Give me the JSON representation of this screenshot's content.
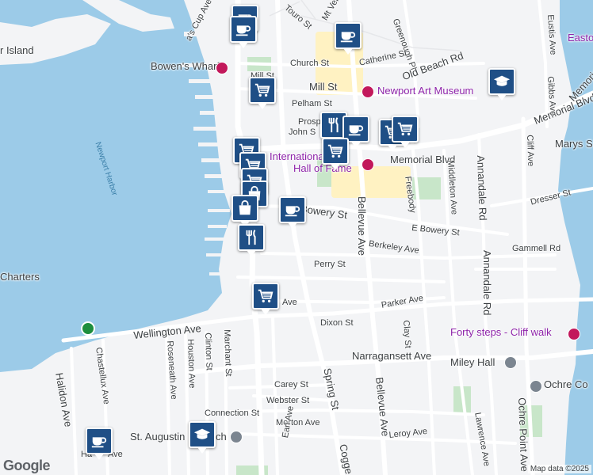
{
  "map": {
    "attribution": "Map data ©2025",
    "logo": "Google",
    "labels": {
      "island": "r Island",
      "newport_harbor": "Newport Harbor",
      "charters": "Charters",
      "americas_cup_ave": "a's Cup Ave",
      "bowens_wharf": "Bowen's Wharf",
      "touro_st": "Touro St",
      "mt_vernon": "Mt Vern",
      "greenough_pl": "Greenough Pl",
      "catherine_st": "Catherine St",
      "old_beach_rd": "Old Beach Rd",
      "church_st": "Church St",
      "mill_st_w": "Mill St",
      "mill_st_e": "Mill St",
      "pelham_st": "Pelham St",
      "newport_art_museum": "Newport Art Museum",
      "prospect": "Prosp",
      "john_s": "John S",
      "intl_tennis": "International",
      "hall_of_fame": "Hall of Fame",
      "memorial_blvd": "Memorial Blvd",
      "memorial_blvd_e": "Memorial Blvd",
      "bowery_st": "Bowery St",
      "e_bowery_st": "E Bowery St",
      "bellevue_ave": "Bellevue Ave",
      "freebody": "Freebody",
      "middleton_ave": "Middleton Ave",
      "annandale_rd": "Annandale Rd",
      "annandale_rd2": "Annandale Rd",
      "dresser_st": "Dresser St",
      "gammell_rd": "Gammell Rd",
      "berkeley_ave": "Berkeley Ave",
      "perry_st": "Perry St",
      "parker_ave": "Parker Ave",
      "ave_small": "Ave",
      "dixon_st": "Dixon St",
      "wellington_ave": "Wellington Ave",
      "forty_steps": "Forty steps - Cliff walk",
      "narragansett_ave": "Narragansett Ave",
      "miley_hall": "Miley Hall",
      "ochre_court": "Ochre Co",
      "carey_st": "Carey St",
      "webster_st": "Webster St",
      "connection_st": "Connection St",
      "morton_ave": "Morton Ave",
      "leroy_ave": "Leroy Ave",
      "lawrence_ave": "Lawrence Ave",
      "ochre_point_ave": "Ochre Point Ave",
      "st_augustin": "St. Augustin",
      "ch": "ch",
      "halidon_ave": "Halidon Ave",
      "halidon_ave2": "Ave",
      "ha": "Ha",
      "chastellux_ave": "Chastellux Ave",
      "roseneath_ave": "Roseneath Ave",
      "houston_ave": "Houston Ave",
      "clinton_st": "Clinton St",
      "marchant_st": "Marchant St",
      "earl_ave": "Earl Ave",
      "spring_st": "Spring St",
      "cogge": "Cogge",
      "clay_st": "Clay St",
      "cliff_ave": "Cliff Ave",
      "gibbs_ave": "Gibbs Ave",
      "eustis_ave": "Eustis Ave",
      "marys": "Marys S",
      "easton": "Easto",
      "memorial_blvd_far": "Memorial Blv"
    },
    "pins": [
      {
        "type": "coffee",
        "icon": "coffee-cup-icon"
      },
      {
        "type": "coffee",
        "icon": "coffee-cup-icon"
      },
      {
        "type": "coffee",
        "icon": "coffee-cup-icon"
      },
      {
        "type": "shopping",
        "icon": "shopping-cart-icon"
      },
      {
        "type": "school",
        "icon": "graduation-cap-icon"
      },
      {
        "type": "restaurant",
        "icon": "fork-knife-icon"
      },
      {
        "type": "coffee",
        "icon": "coffee-cup-icon"
      },
      {
        "type": "shopping",
        "icon": "shopping-cart-icon"
      },
      {
        "type": "shopping",
        "icon": "shopping-cart-icon"
      },
      {
        "type": "shopping",
        "icon": "shopping-cart-icon"
      },
      {
        "type": "shopping",
        "icon": "shopping-cart-icon"
      },
      {
        "type": "shopping",
        "icon": "shopping-cart-icon"
      },
      {
        "type": "shopping",
        "icon": "shopping-cart-icon"
      },
      {
        "type": "bag",
        "icon": "shopping-bag-icon"
      },
      {
        "type": "bag",
        "icon": "shopping-bag-icon"
      },
      {
        "type": "coffee",
        "icon": "coffee-cup-icon"
      },
      {
        "type": "restaurant",
        "icon": "fork-knife-icon"
      },
      {
        "type": "shopping",
        "icon": "shopping-cart-icon"
      },
      {
        "type": "coffee",
        "icon": "coffee-cup-icon"
      },
      {
        "type": "school",
        "icon": "graduation-cap-icon"
      }
    ],
    "colors": {
      "water": "#9ccbe8",
      "land": "#f3f4f6",
      "park": "#c8e6c9",
      "pin": "#1f4f86",
      "poi": "#c2185b"
    }
  }
}
